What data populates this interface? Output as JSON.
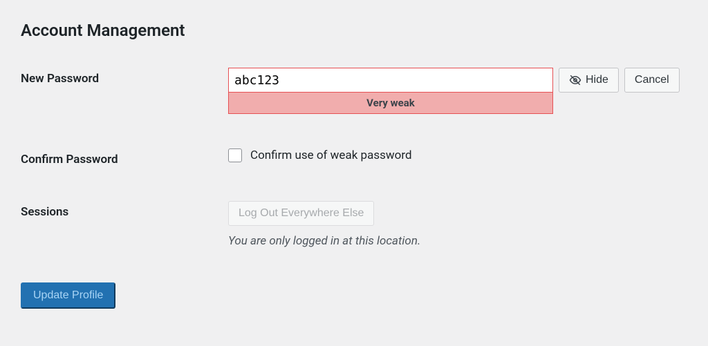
{
  "section_title": "Account Management",
  "new_password": {
    "label": "New Password",
    "value": "abc123",
    "strength_text": "Very weak"
  },
  "hide_button": "Hide",
  "cancel_button": "Cancel",
  "confirm_password": {
    "label": "Confirm Password",
    "checkbox_label": "Confirm use of weak password"
  },
  "sessions": {
    "label": "Sessions",
    "button": "Log Out Everywhere Else",
    "description": "You are only logged in at this location."
  },
  "submit_button": "Update Profile"
}
